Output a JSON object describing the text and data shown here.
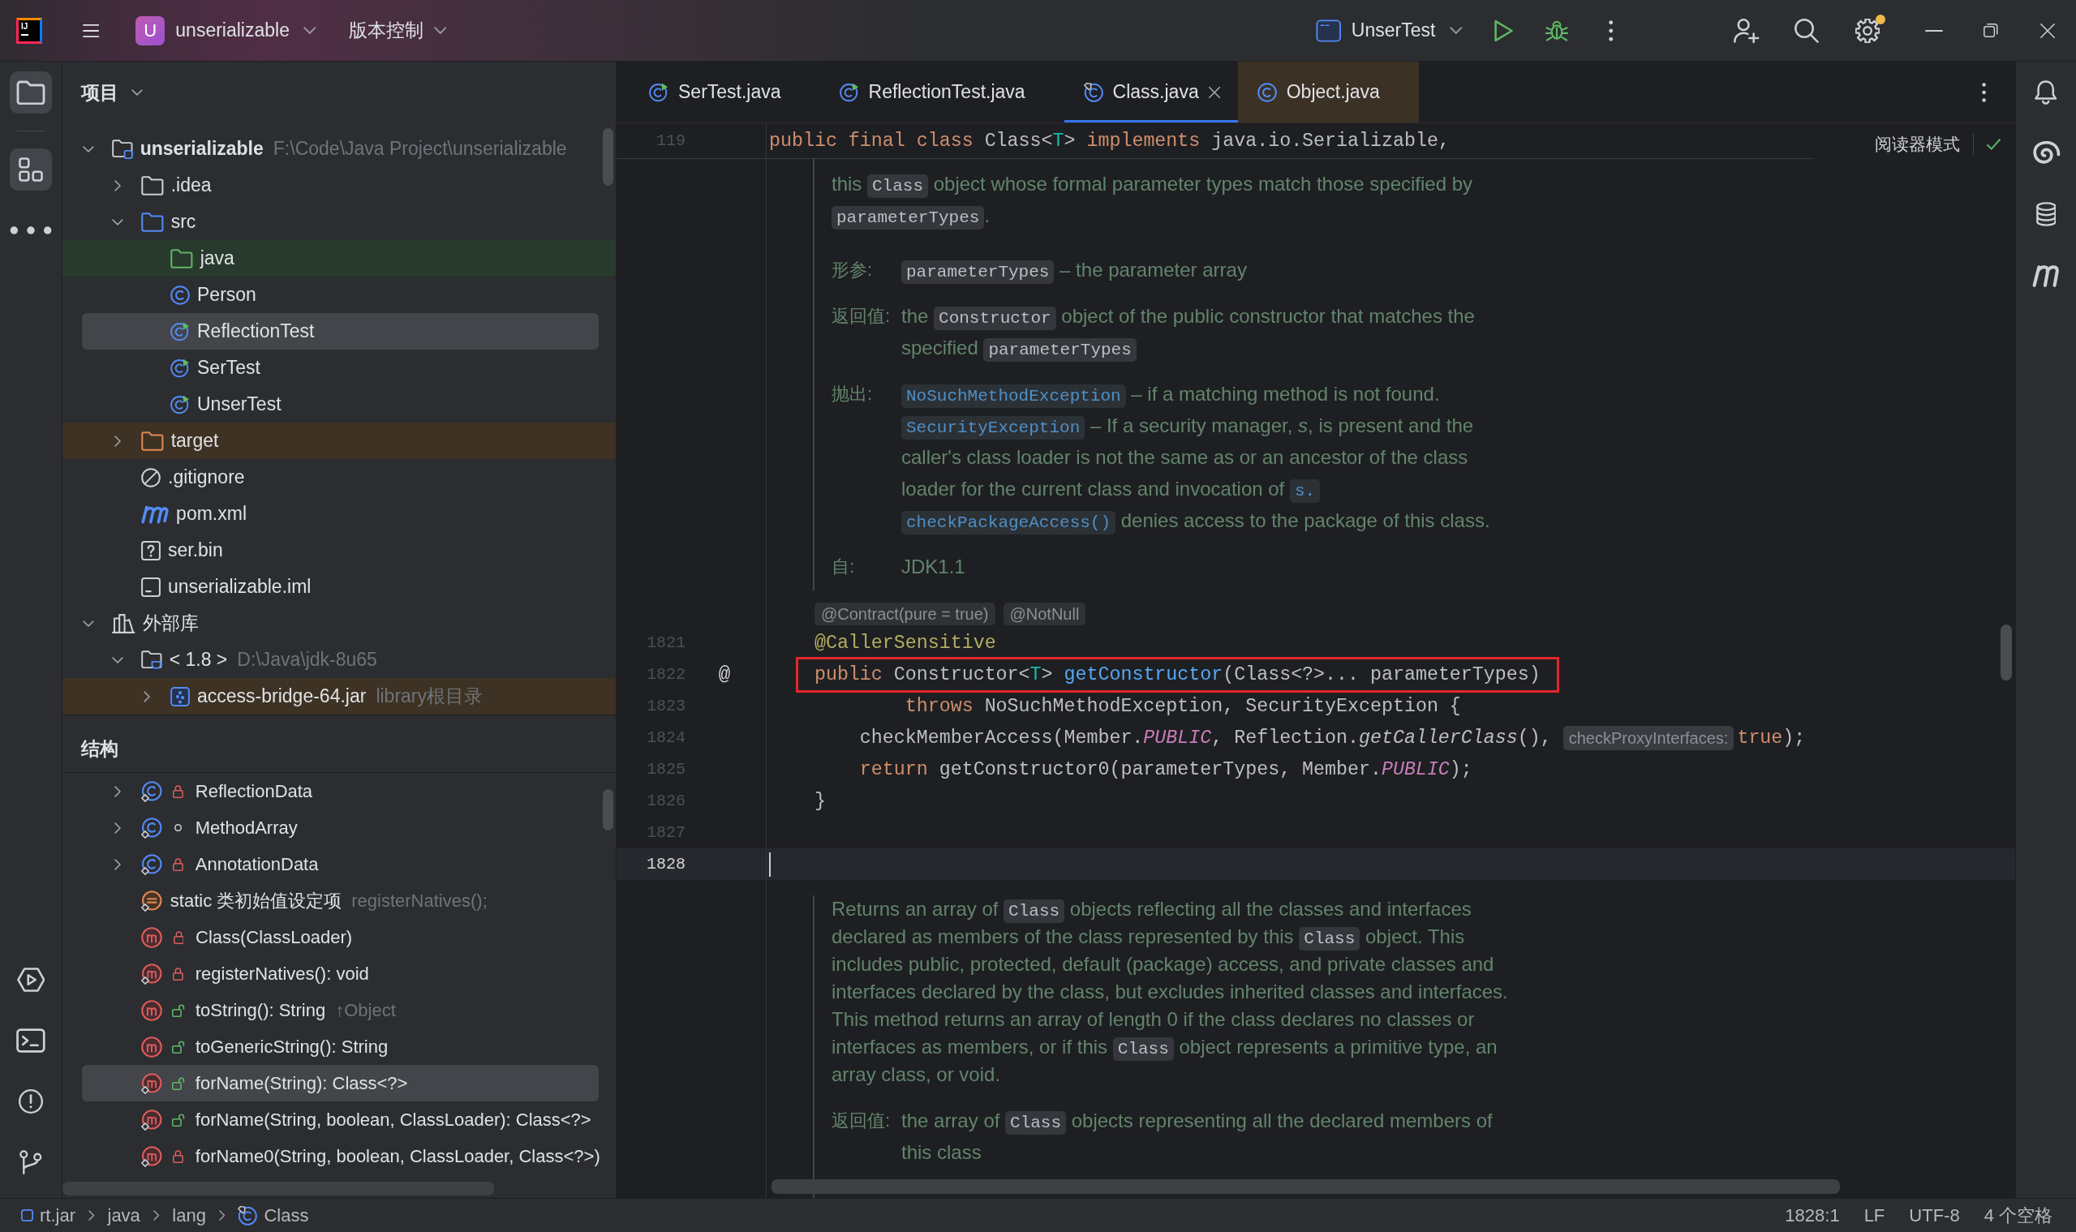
{
  "title_bar": {
    "logo_text": "IJ",
    "project_initial": "U",
    "project_name": "unserializable",
    "vcs_label": "版本控制",
    "run_config": "UnserTest",
    "settings_badge": true
  },
  "left_toolbar": {
    "top": [
      {
        "kind": "project",
        "selected": true
      },
      {
        "kind": "structure",
        "selected": true
      },
      {
        "kind": "more",
        "selected": false
      }
    ],
    "bottom": [
      {
        "kind": "run",
        "selected": false
      },
      {
        "kind": "terminal",
        "selected": false
      },
      {
        "kind": "problems",
        "selected": false
      },
      {
        "kind": "git",
        "selected": false
      }
    ]
  },
  "project_panel": {
    "title": "项目",
    "tree": [
      {
        "kind": "module",
        "label": "unserializable",
        "hint": "F:\\Code\\Java Project\\unserializable",
        "expanded": true,
        "selected": false,
        "children": [
          {
            "kind": "folder",
            "label": ".idea",
            "expanded": false,
            "selected": false
          },
          {
            "kind": "source-folder",
            "label": "src",
            "expanded": true,
            "selected": false,
            "children": [
              {
                "kind": "test-folder",
                "label": "java",
                "color": "#283a2d",
                "selected": false
              },
              {
                "kind": "class",
                "label": "Person",
                "selected": false
              },
              {
                "kind": "runnable-class",
                "label": "ReflectionTest",
                "selected": true
              },
              {
                "kind": "runnable-class",
                "label": "SerTest",
                "selected": false
              },
              {
                "kind": "runnable-class",
                "label": "UnserTest",
                "selected": false
              }
            ]
          },
          {
            "kind": "excluded-folder",
            "label": "target",
            "color": "#3d3223",
            "expanded": false,
            "selected": false
          },
          {
            "kind": "ignore-file",
            "label": ".gitignore",
            "selected": false
          },
          {
            "kind": "maven-file",
            "label": "pom.xml",
            "selected": false
          },
          {
            "kind": "unknown-file",
            "label": "ser.bin",
            "selected": false
          },
          {
            "kind": "module-file",
            "label": "unserializable.iml",
            "selected": false
          }
        ]
      },
      {
        "kind": "libraries",
        "label": "外部库",
        "expanded": true,
        "selected": false,
        "children": [
          {
            "kind": "jdk",
            "label": "< 1.8 >",
            "hint": "D:\\Java\\jdk-8u65",
            "expanded": true,
            "selected": false,
            "children": [
              {
                "kind": "jar",
                "label": "access-bridge-64.jar",
                "hint": "library根目录",
                "color": "#3d3223",
                "expanded": false,
                "selected": false
              }
            ]
          }
        ]
      }
    ]
  },
  "structure_panel": {
    "title": "结构",
    "items": [
      {
        "kind": "private-class",
        "label": "ReflectionData",
        "static": true,
        "expanded": false,
        "selected": false
      },
      {
        "kind": "package-class",
        "label": "MethodArray",
        "static": true,
        "expanded": false,
        "selected": false
      },
      {
        "kind": "private-class",
        "label": "AnnotationData",
        "static": true,
        "expanded": false,
        "selected": false
      },
      {
        "kind": "initializer",
        "label": "static 类初始值设定项",
        "hint": "registerNatives();",
        "static": true,
        "selected": false
      },
      {
        "kind": "private-method",
        "label": "Class(ClassLoader)",
        "static": false,
        "selected": false
      },
      {
        "kind": "private-method",
        "label": "registerNatives(): void",
        "static": true,
        "selected": false
      },
      {
        "kind": "public-method",
        "label": "toString(): String",
        "hint": "↑Object",
        "static": false,
        "selected": false
      },
      {
        "kind": "public-method",
        "label": "toGenericString(): String",
        "static": false,
        "selected": false
      },
      {
        "kind": "public-method",
        "label": "forName(String): Class<?>",
        "static": true,
        "selected": true
      },
      {
        "kind": "public-method",
        "label": "forName(String, boolean, ClassLoader): Class<?>",
        "static": true,
        "selected": false
      },
      {
        "kind": "private-method",
        "label": "forName0(String, boolean, ClassLoader, Class<?>)",
        "static": true,
        "selected": false
      }
    ]
  },
  "editor": {
    "tabs": [
      {
        "label": "SerTest.java",
        "kind": "runnable-class",
        "selected": false,
        "tinted": false
      },
      {
        "label": "ReflectionTest.java",
        "kind": "runnable-class",
        "selected": false,
        "tinted": false
      },
      {
        "label": "Class.java",
        "kind": "library-class",
        "selected": true,
        "tinted": false
      },
      {
        "label": "Object.java",
        "kind": "class",
        "selected": false,
        "tinted": true
      }
    ],
    "sticky_line": {
      "number": "119",
      "tokens": [
        {
          "kind": "keyword",
          "text": "public final class "
        },
        {
          "kind": "plain",
          "text": "Class<"
        },
        {
          "kind": "type-param",
          "text": "T"
        },
        {
          "kind": "plain",
          "text": "> "
        },
        {
          "kind": "keyword",
          "text": "implements "
        },
        {
          "kind": "plain",
          "text": "java.io.Serializable,"
        }
      ]
    },
    "reader_mode": "阅读器模式",
    "inspection_ok": true,
    "blocks": [
      {
        "kind": "doc",
        "lines": [
          [
            {
              "kind": "text",
              "text": "this "
            },
            {
              "kind": "code",
              "text": "Class"
            },
            {
              "kind": "text",
              "text": " object whose formal parameter types match those specified by"
            }
          ],
          [
            {
              "kind": "code",
              "text": "parameterTypes"
            },
            {
              "kind": "text",
              "text": "."
            }
          ]
        ],
        "tags": [
          {
            "label": "形参:",
            "lines": [
              [
                {
                  "kind": "code",
                  "text": "parameterTypes"
                },
                {
                  "kind": "text",
                  "text": " – the parameter array"
                }
              ]
            ]
          },
          {
            "label": "返回值:",
            "lines": [
              [
                {
                  "kind": "text",
                  "text": "the "
                },
                {
                  "kind": "code",
                  "text": "Constructor"
                },
                {
                  "kind": "text",
                  "text": " object of the public constructor that matches the"
                }
              ],
              [
                {
                  "kind": "text",
                  "text": "specified "
                },
                {
                  "kind": "code",
                  "text": "parameterTypes"
                }
              ]
            ]
          },
          {
            "label": "抛出:",
            "lines": [
              [
                {
                  "kind": "link",
                  "text": "NoSuchMethodException"
                },
                {
                  "kind": "text",
                  "text": " – if a matching method is not found."
                }
              ],
              [
                {
                  "kind": "link",
                  "text": "SecurityException"
                },
                {
                  "kind": "text",
                  "text": " – If a security manager, *s*, is present and the"
                }
              ],
              [
                {
                  "kind": "text",
                  "text": "caller's class loader is not the same as or an ancestor of the class"
                }
              ],
              [
                {
                  "kind": "text",
                  "text": "loader for the current class and invocation of "
                },
                {
                  "kind": "link",
                  "text": "s."
                }
              ],
              [
                {
                  "kind": "link",
                  "text": "checkPackageAccess()"
                },
                {
                  "kind": "text",
                  "text": " denies access to the package of this class."
                }
              ]
            ]
          },
          {
            "label": "自:",
            "lines": [
              [
                {
                  "kind": "text",
                  "text": "JDK1.1"
                }
              ]
            ]
          }
        ]
      },
      {
        "kind": "inlay",
        "hints": [
          "@Contract(pure = true)",
          "@NotNull"
        ]
      },
      {
        "kind": "code",
        "lines": [
          {
            "number": "1821",
            "current": false,
            "boxed": false,
            "tokens": [
              {
                "kind": "annotation",
                "text": "    @CallerSensitive"
              }
            ]
          },
          {
            "number": "1822",
            "current": false,
            "boxed": true,
            "gutter": "@",
            "tokens": [
              {
                "kind": "keyword",
                "text": "    public "
              },
              {
                "kind": "plain",
                "text": "Constructor<"
              },
              {
                "kind": "type-param",
                "text": "T"
              },
              {
                "kind": "plain",
                "text": "> "
              },
              {
                "kind": "method-decl",
                "text": "getConstructor"
              },
              {
                "kind": "plain",
                "text": "(Class<?>... parameterTypes)"
              }
            ]
          },
          {
            "number": "1823",
            "current": false,
            "boxed": false,
            "tokens": [
              {
                "kind": "keyword",
                "text": "            throws "
              },
              {
                "kind": "plain",
                "text": "NoSuchMethodException, SecurityException {"
              }
            ]
          },
          {
            "number": "1824",
            "current": false,
            "boxed": false,
            "tokens": [
              {
                "kind": "plain",
                "text": "        checkMemberAccess(Member."
              },
              {
                "kind": "static-field",
                "text": "PUBLIC"
              },
              {
                "kind": "plain",
                "text": ", Reflection."
              },
              {
                "kind": "static-call",
                "text": "getCallerClass"
              },
              {
                "kind": "plain",
                "text": "(), "
              },
              {
                "kind": "hint",
                "text": "checkProxyInterfaces:"
              },
              {
                "kind": "keyword",
                "text": "true"
              },
              {
                "kind": "plain",
                "text": ");"
              }
            ]
          },
          {
            "number": "1825",
            "current": false,
            "boxed": false,
            "tokens": [
              {
                "kind": "keyword",
                "text": "        return "
              },
              {
                "kind": "plain",
                "text": "getConstructor0(parameterTypes, Member."
              },
              {
                "kind": "static-field",
                "text": "PUBLIC"
              },
              {
                "kind": "plain",
                "text": ");"
              }
            ]
          },
          {
            "number": "1826",
            "current": false,
            "boxed": false,
            "tokens": [
              {
                "kind": "plain",
                "text": "    }"
              }
            ]
          },
          {
            "number": "1827",
            "current": false,
            "boxed": false
          },
          {
            "number": "1828",
            "current": true,
            "boxed": false
          }
        ]
      },
      {
        "kind": "doc",
        "lines": [
          [
            {
              "kind": "text",
              "text": "Returns an array of "
            },
            {
              "kind": "code",
              "text": "Class"
            },
            {
              "kind": "text",
              "text": " objects reflecting all the classes and interfaces"
            }
          ],
          [
            {
              "kind": "text",
              "text": "declared as members of the class represented by this "
            },
            {
              "kind": "code",
              "text": "Class"
            },
            {
              "kind": "text",
              "text": " object. This"
            }
          ],
          [
            {
              "kind": "text",
              "text": "includes public, protected, default (package) access, and private classes and"
            }
          ],
          [
            {
              "kind": "text",
              "text": "interfaces declared by the class, but excludes inherited classes and interfaces."
            }
          ],
          [
            {
              "kind": "text",
              "text": "This method returns an array of length 0 if the class declares no classes or"
            }
          ],
          [
            {
              "kind": "text",
              "text": "interfaces as members, or if this "
            },
            {
              "kind": "code",
              "text": "Class"
            },
            {
              "kind": "text",
              "text": " object represents a primitive type, an"
            }
          ],
          [
            {
              "kind": "text",
              "text": "array class, or void."
            }
          ]
        ],
        "tags": [
          {
            "label": "返回值:",
            "lines": [
              [
                {
                  "kind": "text",
                  "text": "the array of "
                },
                {
                  "kind": "code",
                  "text": "Class"
                },
                {
                  "kind": "text",
                  "text": " objects representing all the declared members of"
                }
              ],
              [
                {
                  "kind": "text",
                  "text": "this class"
                }
              ]
            ]
          }
        ]
      }
    ]
  },
  "right_toolbar": [
    {
      "kind": "notifications"
    },
    {
      "kind": "ai-assistant"
    },
    {
      "kind": "database"
    },
    {
      "kind": "maven"
    }
  ],
  "status_bar": {
    "breadcrumbs": [
      {
        "kind": "module",
        "label": "rt.jar"
      },
      {
        "kind": "package",
        "label": "java"
      },
      {
        "kind": "package",
        "label": "lang"
      },
      {
        "kind": "library-class",
        "label": "Class"
      }
    ],
    "position": "1828:1",
    "line_separator": "LF",
    "encoding": "UTF-8",
    "indent": "4 个空格"
  }
}
